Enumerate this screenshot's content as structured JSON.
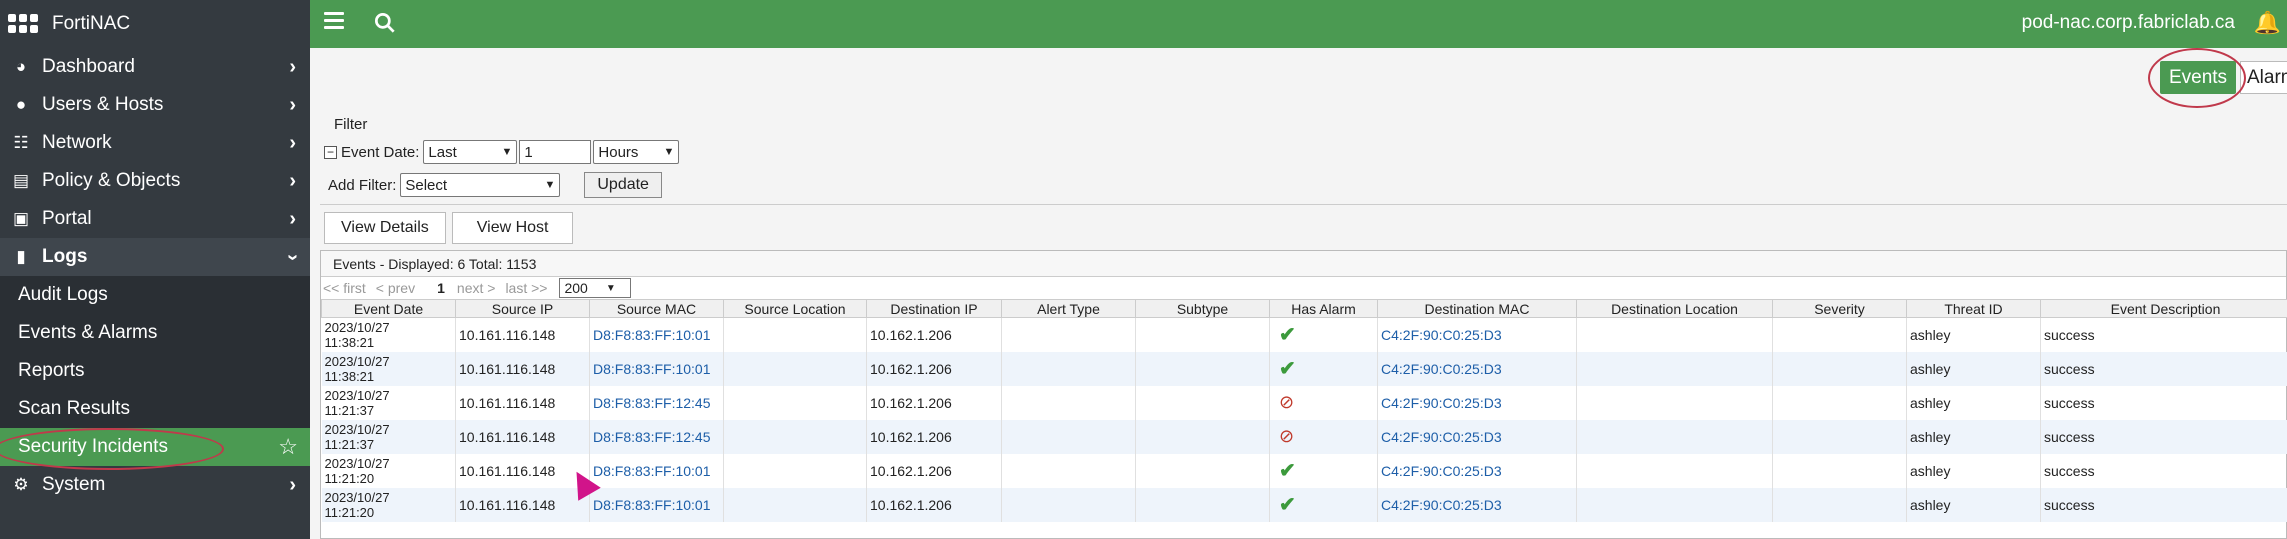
{
  "app": {
    "name": "FortiNAC",
    "host": "pod-nac.corp.fabriclab.ca"
  },
  "sidebar": {
    "items": [
      {
        "label": "Dashboard",
        "icon": "dashboard-icon"
      },
      {
        "label": "Users & Hosts",
        "icon": "user-icon"
      },
      {
        "label": "Network",
        "icon": "network-icon"
      },
      {
        "label": "Policy & Objects",
        "icon": "policy-icon"
      },
      {
        "label": "Portal",
        "icon": "portal-icon"
      },
      {
        "label": "Logs",
        "icon": "logs-icon"
      },
      {
        "label": "System",
        "icon": "gear-icon"
      }
    ],
    "logs_children": [
      "Audit Logs",
      "Events & Alarms",
      "Reports",
      "Scan Results",
      "Security Incidents"
    ]
  },
  "tabs": {
    "events": "Events",
    "alarms": "Alarms"
  },
  "filter": {
    "title": "Filter",
    "event_date_label": "Event Date:",
    "event_date_range": "Last",
    "event_date_value": "1",
    "event_date_unit": "Hours",
    "add_filter_label": "Add Filter:",
    "add_filter_value": "Select",
    "update_label": "Update"
  },
  "actions": {
    "view_details": "View Details",
    "view_host": "View Host"
  },
  "events": {
    "summary": "Events - Displayed: 6 Total: 1153",
    "pager": {
      "first": "<< first",
      "prev": "< prev",
      "page": "1",
      "next": "next >",
      "last": "last >>",
      "page_size": "200"
    },
    "columns": [
      "Event Date",
      "Source IP",
      "Source MAC",
      "Source Location",
      "Destination IP",
      "Alert Type",
      "Subtype",
      "Has Alarm",
      "Destination MAC",
      "Destination Location",
      "Severity",
      "Threat ID",
      "Event Description"
    ],
    "rows": [
      {
        "date1": "2023/10/27",
        "date2": "11:38:21",
        "src_ip": "10.161.116.148",
        "src_mac": "D8:F8:83:FF:10:01",
        "dst_ip": "10.162.1.206",
        "alarm": "check",
        "dst_mac": "C4:2F:90:C0:25:D3",
        "threat": "ashley",
        "desc": "success"
      },
      {
        "date1": "2023/10/27",
        "date2": "11:38:21",
        "src_ip": "10.161.116.148",
        "src_mac": "D8:F8:83:FF:10:01",
        "dst_ip": "10.162.1.206",
        "alarm": "check",
        "dst_mac": "C4:2F:90:C0:25:D3",
        "threat": "ashley",
        "desc": "success"
      },
      {
        "date1": "2023/10/27",
        "date2": "11:21:37",
        "src_ip": "10.161.116.148",
        "src_mac": "D8:F8:83:FF:12:45",
        "dst_ip": "10.162.1.206",
        "alarm": "blocked",
        "dst_mac": "C4:2F:90:C0:25:D3",
        "threat": "ashley",
        "desc": "success"
      },
      {
        "date1": "2023/10/27",
        "date2": "11:21:37",
        "src_ip": "10.161.116.148",
        "src_mac": "D8:F8:83:FF:12:45",
        "dst_ip": "10.162.1.206",
        "alarm": "blocked",
        "dst_mac": "C4:2F:90:C0:25:D3",
        "threat": "ashley",
        "desc": "success"
      },
      {
        "date1": "2023/10/27",
        "date2": "11:21:20",
        "src_ip": "10.161.116.148",
        "src_mac": "D8:F8:83:FF:10:01",
        "dst_ip": "10.162.1.206",
        "alarm": "check",
        "dst_mac": "C4:2F:90:C0:25:D3",
        "threat": "ashley",
        "desc": "success"
      },
      {
        "date1": "2023/10/27",
        "date2": "11:21:20",
        "src_ip": "10.161.116.148",
        "src_mac": "D8:F8:83:FF:10:01",
        "dst_ip": "10.162.1.206",
        "alarm": "check",
        "dst_mac": "C4:2F:90:C0:25:D3",
        "threat": "ashley",
        "desc": "success"
      }
    ]
  },
  "colors": {
    "brand_green": "#4b9a52",
    "sidebar_bg": "#343a40",
    "highlight_ring": "#c0394b",
    "link_blue": "#1d5ea8"
  }
}
